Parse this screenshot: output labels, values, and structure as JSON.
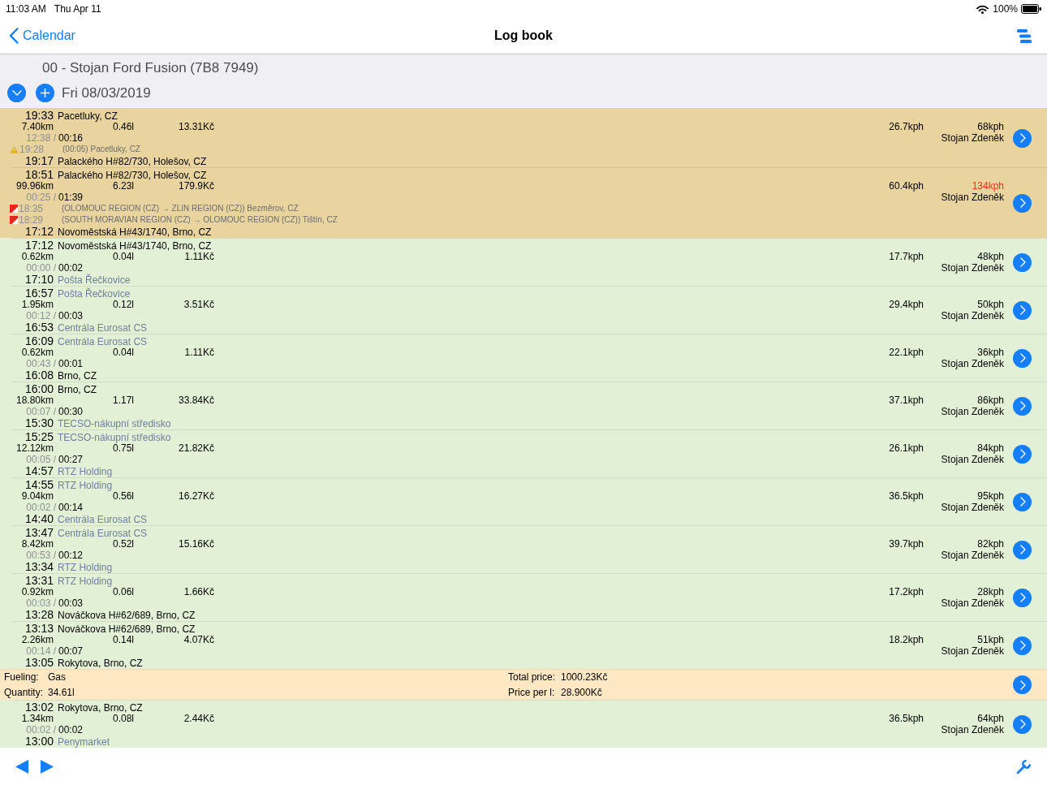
{
  "status_bar": {
    "time": "11:03 AM",
    "date": "Thu Apr 11",
    "battery": "100%"
  },
  "nav": {
    "back": "Calendar",
    "title": "Log book"
  },
  "header": {
    "vehicle": "00 - Stojan Ford Fusion (7B8 7949)",
    "date": "Fri 08/03/2019"
  },
  "entries": [
    {
      "kind": "trip",
      "color": "#e9d49f",
      "start": {
        "time": "19:33",
        "place": "Pacetluky, CZ",
        "poi": false
      },
      "distance": "7.40km",
      "fuel": "0.46l",
      "cost": "13.31Kč",
      "stop_time": "12:38 /",
      "drive_time": "00:16",
      "events": [
        {
          "kind": "warning",
          "time": "19:28",
          "text": "(00:05) Pacetluky, CZ"
        }
      ],
      "end": {
        "time": "19:17",
        "place": "Palackého H#82/730, Holešov, CZ",
        "poi": false
      },
      "avg_speed": "26.7kph",
      "max_speed": "68kph",
      "speeding": false,
      "driver": "Stojan Zdeněk"
    },
    {
      "kind": "trip",
      "color": "#e9d49f",
      "start": {
        "time": "18:51",
        "place": "Palackého H#82/730, Holešov, CZ",
        "poi": false
      },
      "distance": "99.96km",
      "fuel": "6.23l",
      "cost": "179.9Kč",
      "stop_time": "00:25 /",
      "drive_time": "01:39",
      "events": [
        {
          "kind": "border",
          "time": "18:35",
          "text": "(OLOMOUC REGION (CZ) → ZLIN REGION (CZ)) Bezměrov, CZ"
        },
        {
          "kind": "border",
          "time": "18:29",
          "text": "(SOUTH MORAVIAN REGION (CZ) → OLOMOUC REGION (CZ)) Tištín, CZ"
        }
      ],
      "end": {
        "time": "17:12",
        "place": "Novoměstská H#43/1740, Brno, CZ",
        "poi": false
      },
      "avg_speed": "60.4kph",
      "max_speed": "134kph",
      "speeding": true,
      "driver": "Stojan Zdeněk"
    },
    {
      "kind": "trip",
      "color": "#e2f1d6",
      "start": {
        "time": "17:12",
        "place": "Novoměstská H#43/1740, Brno, CZ",
        "poi": false
      },
      "distance": "0.62km",
      "fuel": "0.04l",
      "cost": "1.11Kč",
      "stop_time": "00:00 /",
      "drive_time": "00:02",
      "end": {
        "time": "17:10",
        "place": "Pošta Řečkovice",
        "poi": true
      },
      "avg_speed": "17.7kph",
      "max_speed": "48kph",
      "speeding": false,
      "driver": "Stojan Zdeněk"
    },
    {
      "kind": "trip",
      "color": "#e2f1d6",
      "start": {
        "time": "16:57",
        "place": "Pošta Řečkovice",
        "poi": true
      },
      "distance": "1.95km",
      "fuel": "0.12l",
      "cost": "3.51Kč",
      "stop_time": "00:12 /",
      "drive_time": "00:03",
      "end": {
        "time": "16:53",
        "place": "Centrála Eurosat CS",
        "poi": true
      },
      "avg_speed": "29.4kph",
      "max_speed": "50kph",
      "speeding": false,
      "driver": "Stojan Zdeněk"
    },
    {
      "kind": "trip",
      "color": "#e2f1d6",
      "start": {
        "time": "16:09",
        "place": "Centrála Eurosat CS",
        "poi": true
      },
      "distance": "0.62km",
      "fuel": "0.04l",
      "cost": "1.11Kč",
      "stop_time": "00:43 /",
      "drive_time": "00:01",
      "end": {
        "time": "16:08",
        "place": "Brno, CZ",
        "poi": false
      },
      "avg_speed": "22.1kph",
      "max_speed": "36kph",
      "speeding": false,
      "driver": "Stojan Zdeněk"
    },
    {
      "kind": "trip",
      "color": "#e2f1d6",
      "start": {
        "time": "16:00",
        "place": "Brno, CZ",
        "poi": false
      },
      "distance": "18.80km",
      "fuel": "1.17l",
      "cost": "33.84Kč",
      "stop_time": "00:07 /",
      "drive_time": "00:30",
      "end": {
        "time": "15:30",
        "place": "TECSO-nákupní středisko",
        "poi": true
      },
      "avg_speed": "37.1kph",
      "max_speed": "86kph",
      "speeding": false,
      "driver": "Stojan Zdeněk"
    },
    {
      "kind": "trip",
      "color": "#e2f1d6",
      "start": {
        "time": "15:25",
        "place": "TECSO-nákupní středisko",
        "poi": true
      },
      "distance": "12.12km",
      "fuel": "0.75l",
      "cost": "21.82Kč",
      "stop_time": "00:05 /",
      "drive_time": "00:27",
      "end": {
        "time": "14:57",
        "place": "RTZ Holding",
        "poi": true
      },
      "avg_speed": "26.1kph",
      "max_speed": "84kph",
      "speeding": false,
      "driver": "Stojan Zdeněk"
    },
    {
      "kind": "trip",
      "color": "#e2f1d6",
      "start": {
        "time": "14:55",
        "place": "RTZ Holding",
        "poi": true
      },
      "distance": "9.04km",
      "fuel": "0.56l",
      "cost": "16.27Kč",
      "stop_time": "00:02 /",
      "drive_time": "00:14",
      "end": {
        "time": "14:40",
        "place": "Centrála Eurosat CS",
        "poi": true
      },
      "avg_speed": "36.5kph",
      "max_speed": "95kph",
      "speeding": false,
      "driver": "Stojan Zdeněk"
    },
    {
      "kind": "trip",
      "color": "#e2f1d6",
      "start": {
        "time": "13:47",
        "place": "Centrála Eurosat CS",
        "poi": true
      },
      "distance": "8.42km",
      "fuel": "0.52l",
      "cost": "15.16Kč",
      "stop_time": "00:53 /",
      "drive_time": "00:12",
      "end": {
        "time": "13:34",
        "place": "RTZ Holding",
        "poi": true
      },
      "avg_speed": "39.7kph",
      "max_speed": "82kph",
      "speeding": false,
      "driver": "Stojan Zdeněk"
    },
    {
      "kind": "trip",
      "color": "#e2f1d6",
      "start": {
        "time": "13:31",
        "place": "RTZ Holding",
        "poi": true
      },
      "distance": "0.92km",
      "fuel": "0.06l",
      "cost": "1.66Kč",
      "stop_time": "00:03 /",
      "drive_time": "00:03",
      "end": {
        "time": "13:28",
        "place": "Nováčkova H#62/689, Brno, CZ",
        "poi": false
      },
      "avg_speed": "17.2kph",
      "max_speed": "28kph",
      "speeding": false,
      "driver": "Stojan Zdeněk"
    },
    {
      "kind": "trip",
      "color": "#e2f1d6",
      "start": {
        "time": "13:13",
        "place": "Nováčkova H#62/689, Brno, CZ",
        "poi": false
      },
      "distance": "2.26km",
      "fuel": "0.14l",
      "cost": "4.07Kč",
      "stop_time": "00:14 /",
      "drive_time": "00:07",
      "end": {
        "time": "13:05",
        "place": "Rokytova, Brno, CZ",
        "poi": false
      },
      "avg_speed": "18.2kph",
      "max_speed": "51kph",
      "speeding": false,
      "driver": "Stojan Zdeněk"
    },
    {
      "kind": "fueling",
      "color": "#fde8c3",
      "fields": [
        {
          "label": "Fueling:",
          "value": "Gas"
        },
        {
          "label": "Total price:",
          "value": "1000.23Kč"
        },
        {
          "label": "Quantity:",
          "value": "34.61l"
        },
        {
          "label": "Price per l:",
          "value": "28.900Kč"
        }
      ]
    },
    {
      "kind": "trip",
      "color": "#e2f1d6",
      "start": {
        "time": "13:02",
        "place": "Rokytova, Brno, CZ",
        "poi": false
      },
      "distance": "1.34km",
      "fuel": "0.08l",
      "cost": "2.44Kč",
      "stop_time": "00:02 /",
      "drive_time": "00:02",
      "end": {
        "time": "13:00",
        "place": "Penymarket",
        "poi": true
      },
      "avg_speed": "36.5kph",
      "max_speed": "64kph",
      "speeding": false,
      "driver": "Stojan Zdeněk"
    }
  ]
}
